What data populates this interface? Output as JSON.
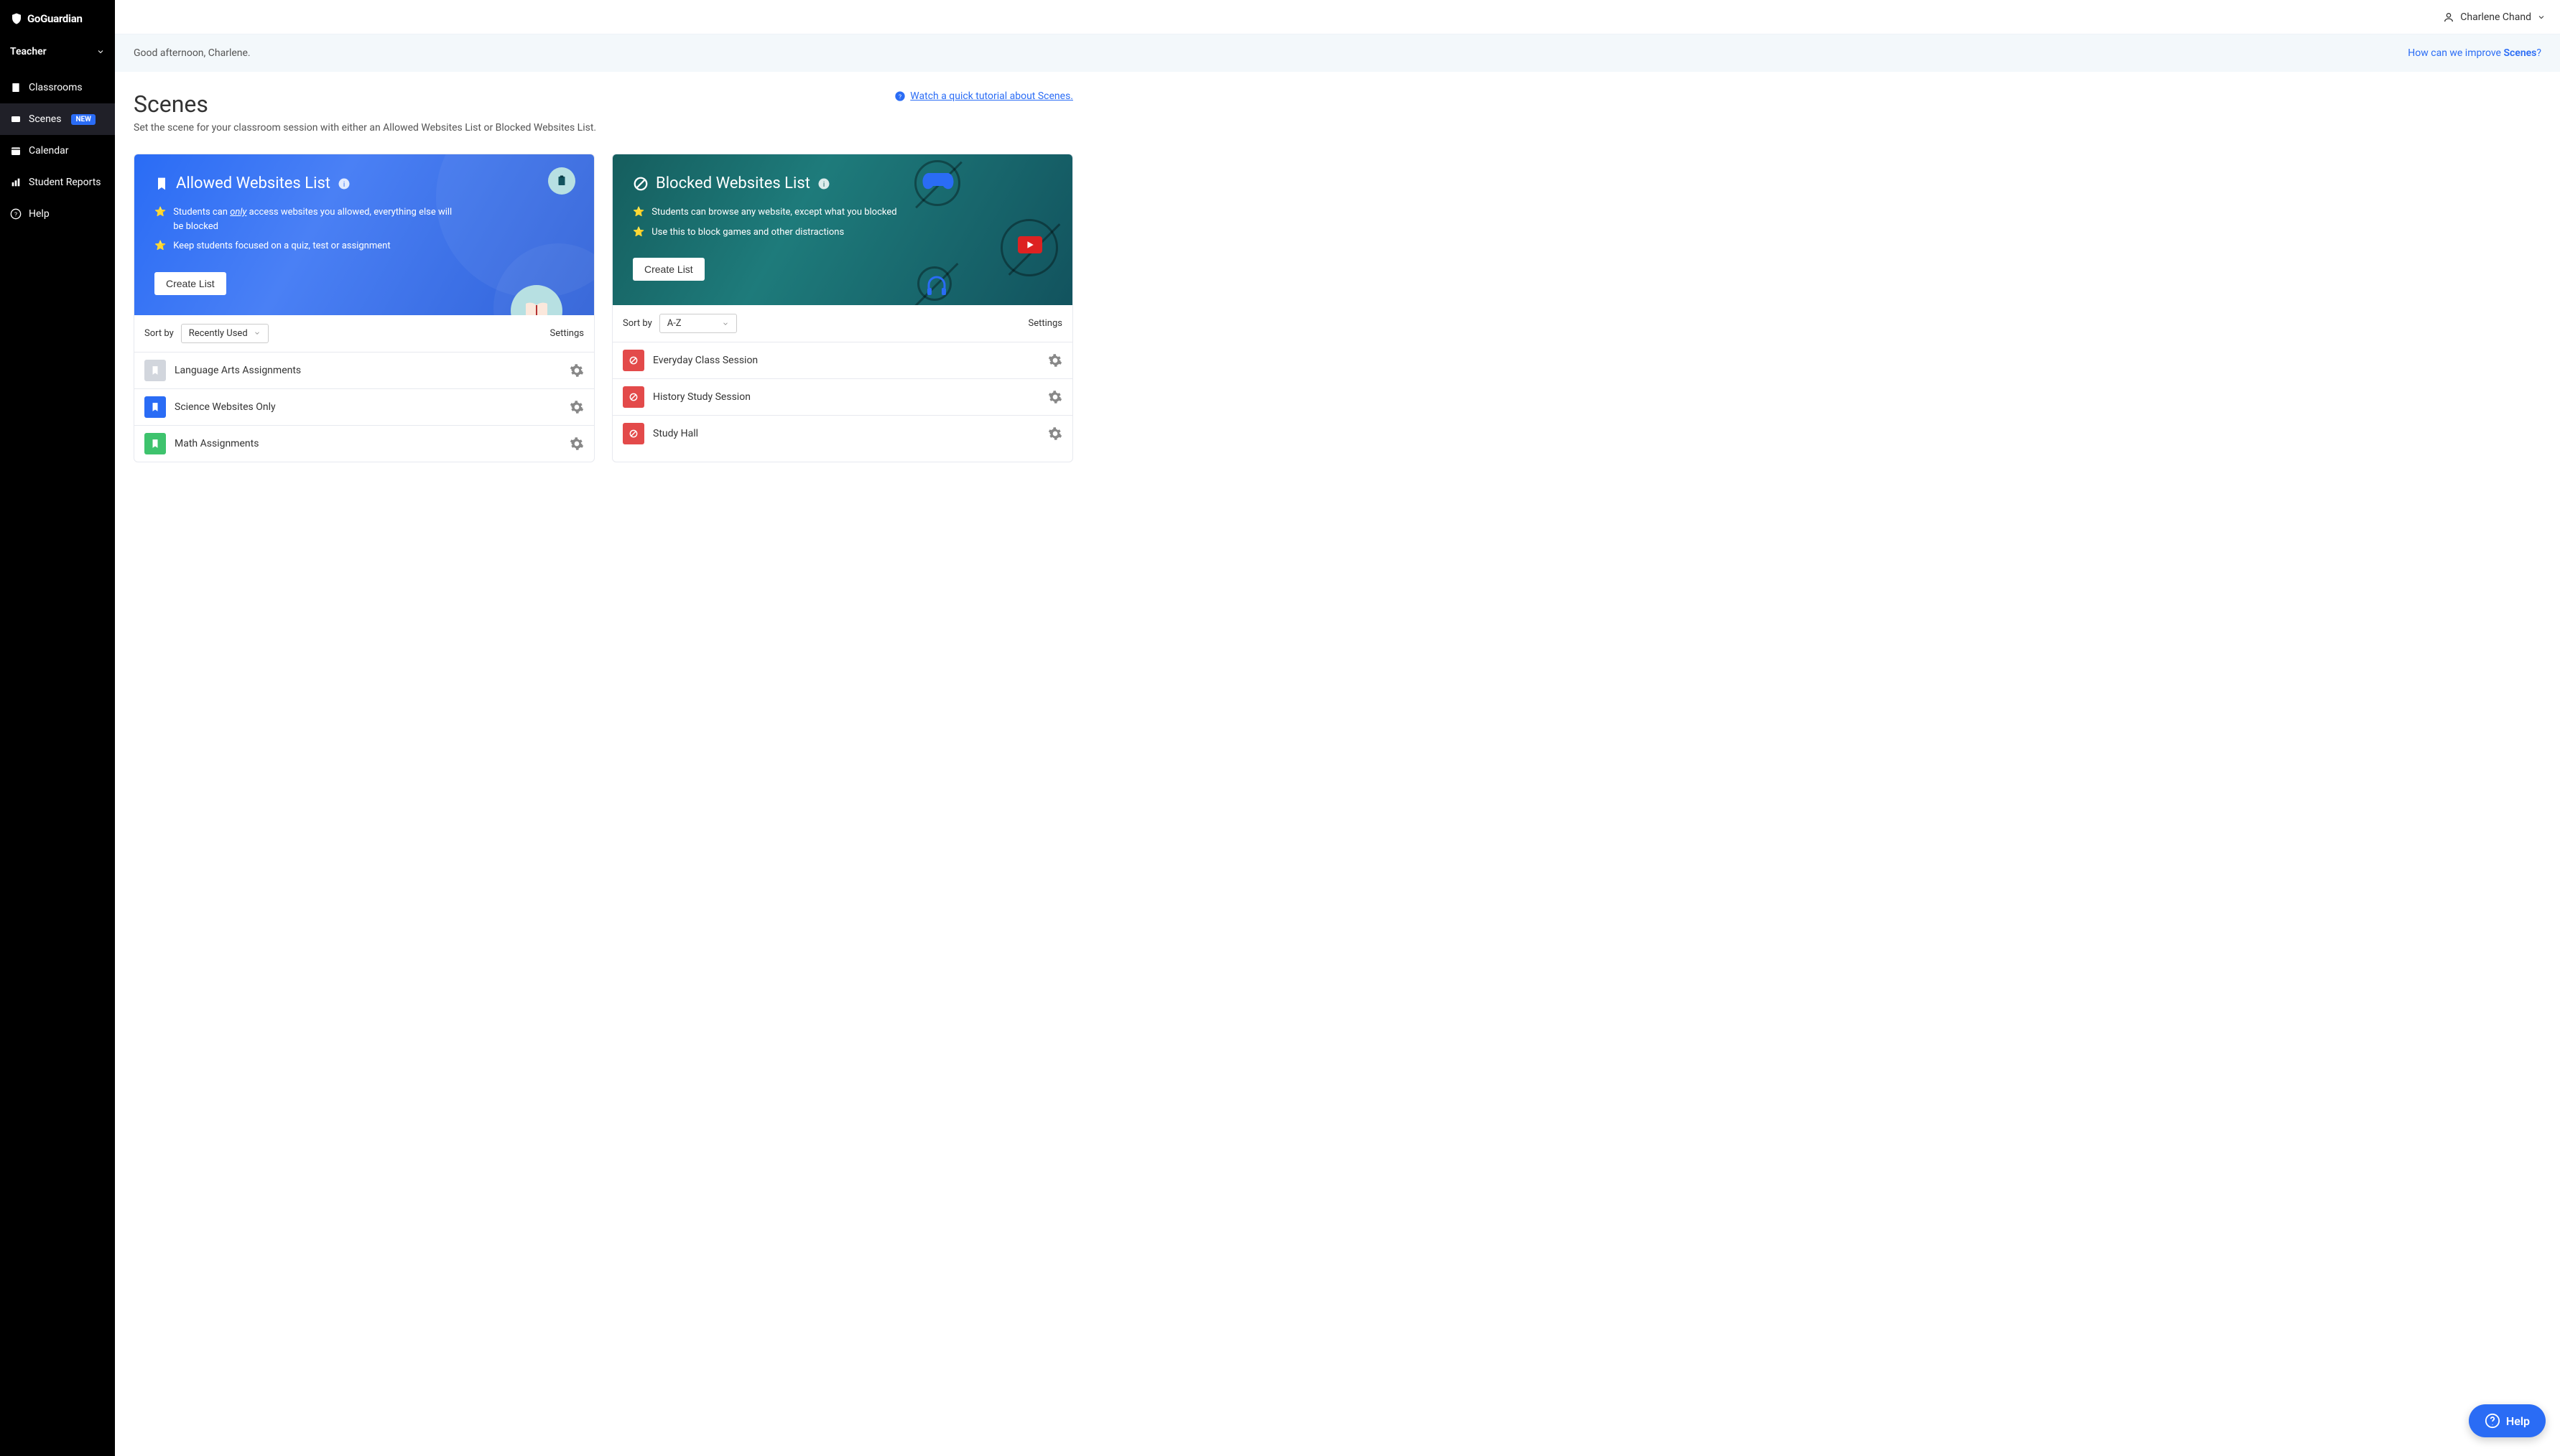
{
  "brand": "GoGuardian",
  "role_label": "Teacher",
  "user_name": "Charlene Chand",
  "greeting": "Good afternoon, Charlene.",
  "feedback_prefix": "How can we improve ",
  "feedback_bold": "Scenes",
  "feedback_suffix": "?",
  "nav": {
    "classrooms": "Classrooms",
    "scenes": "Scenes",
    "scenes_badge": "NEW",
    "calendar": "Calendar",
    "student_reports": "Student Reports",
    "help": "Help"
  },
  "page": {
    "title": "Scenes",
    "subtitle": "Set the scene for your classroom session with either an Allowed Websites List or Blocked Websites List.",
    "tutorial_link": "Watch a quick tutorial about Scenes."
  },
  "allowed": {
    "title": "Allowed Websites List",
    "bullets": [
      {
        "pre": "Students can ",
        "em": "only",
        "post": " access websites you allowed, everything else will be blocked"
      },
      {
        "pre": "Keep students focused on a quiz, test or assignment",
        "em": "",
        "post": ""
      }
    ],
    "create_label": "Create List",
    "sort_label": "Sort by",
    "sort_value": "Recently Used",
    "settings_label": "Settings",
    "items": [
      {
        "label": "Language Arts Assignments",
        "color": "gray"
      },
      {
        "label": "Science Websites Only",
        "color": "blue"
      },
      {
        "label": "Math Assignments",
        "color": "green"
      }
    ]
  },
  "blocked": {
    "title": "Blocked Websites List",
    "bullets": [
      {
        "text": "Students can browse any website, except what you blocked"
      },
      {
        "text": "Use this to block games and other distractions"
      }
    ],
    "create_label": "Create List",
    "sort_label": "Sort by",
    "sort_value": "A-Z",
    "settings_label": "Settings",
    "items": [
      {
        "label": "Everyday Class Session"
      },
      {
        "label": "History Study Session"
      },
      {
        "label": "Study Hall"
      }
    ]
  },
  "help_fab": "Help"
}
